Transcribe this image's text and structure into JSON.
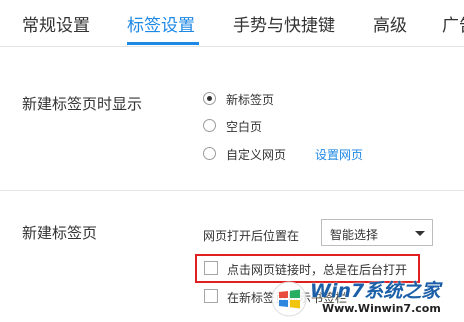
{
  "tabs": [
    {
      "label": "常规设置",
      "active": false
    },
    {
      "label": "标签设置",
      "active": true
    },
    {
      "label": "手势与快捷键",
      "active": false
    },
    {
      "label": "高级",
      "active": false
    },
    {
      "label": "广告",
      "active": false
    }
  ],
  "accent_color": "#1e88e5",
  "new_tab_display": {
    "title": "新建标签页时显示",
    "options": [
      {
        "label": "新标签页",
        "checked": true
      },
      {
        "label": "空白页",
        "checked": false
      },
      {
        "label": "自定义网页",
        "checked": false
      }
    ],
    "set_page_link": "设置网页"
  },
  "new_tab": {
    "title": "新建标签页",
    "position_label": "网页打开后位置在",
    "position_select": "智能选择",
    "checkboxes": [
      {
        "label": "点击网页链接时，总是在后台打开",
        "checked": false,
        "highlighted": true
      },
      {
        "label": "在新标签页显示书签栏",
        "checked": false,
        "highlighted": false
      }
    ]
  },
  "watermark": {
    "brand": "Win7系统之家",
    "url": "Www.Winwin7.com",
    "icon": "windows-logo-icon",
    "highlight_color": "#e02020"
  }
}
